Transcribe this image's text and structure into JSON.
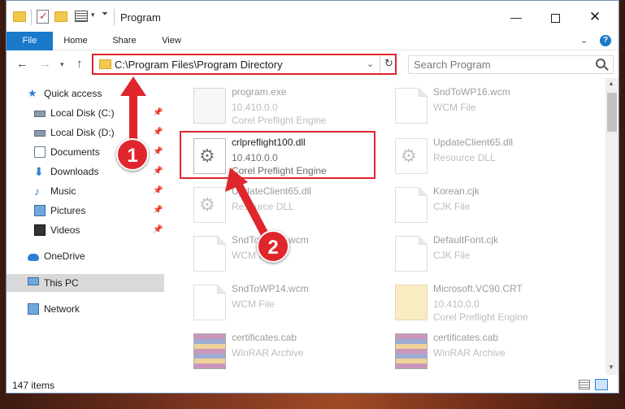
{
  "window": {
    "title": "Program",
    "minimize_glyph": "—",
    "close_glyph": "✕"
  },
  "ribbon": {
    "tabs": [
      "File",
      "Home",
      "Share",
      "View"
    ]
  },
  "nav": {
    "back_glyph": "←",
    "forward_glyph": "→",
    "up_glyph": "↑",
    "address": "C:\\Program Files\\Program Directory",
    "search_placeholder": "Search Program"
  },
  "sidebar": {
    "items": [
      {
        "label": "Quick access",
        "icon": "star-icon",
        "pinned": false
      },
      {
        "label": "Local Disk (C:)",
        "icon": "disk-icon",
        "pinned": true
      },
      {
        "label": "Local Disk (D:)",
        "icon": "disk-icon",
        "pinned": true
      },
      {
        "label": "Documents",
        "icon": "documents-icon",
        "pinned": true
      },
      {
        "label": "Downloads",
        "icon": "download-icon",
        "pinned": true
      },
      {
        "label": "Music",
        "icon": "music-icon",
        "pinned": true
      },
      {
        "label": "Pictures",
        "icon": "pictures-icon",
        "pinned": true
      },
      {
        "label": "Videos",
        "icon": "videos-icon",
        "pinned": true
      },
      {
        "label": "OneDrive",
        "icon": "onedrive-icon",
        "pinned": false
      },
      {
        "label": "This PC",
        "icon": "this-pc-icon",
        "pinned": false,
        "selected": true
      },
      {
        "label": "Network",
        "icon": "network-icon",
        "pinned": false
      }
    ]
  },
  "files": [
    {
      "name": "program.exe",
      "line2": "10.410.0.0",
      "line3": "Corel Preflight Engine",
      "icon": "exe-icon",
      "faded": true
    },
    {
      "name": "SndToWP16.wcm",
      "line2": "WCM File",
      "line3": "",
      "icon": "file-icon",
      "faded": true
    },
    {
      "name": "crlpreflight100.dll",
      "line2": "10.410.0.0",
      "line3": "Corel Preflight Engine",
      "icon": "dll-icon",
      "faded": false
    },
    {
      "name": "UpdateClient65.dll",
      "line2": "Resource DLL",
      "line3": "",
      "icon": "dll-icon",
      "faded": true
    },
    {
      "name": "UpdateClient65.dll",
      "line2": "Resource DLL",
      "line3": "",
      "icon": "dll-icon",
      "faded": true
    },
    {
      "name": "Korean.cjk",
      "line2": "CJK File",
      "line3": "",
      "icon": "file-icon",
      "faded": true
    },
    {
      "name": "SndToWP15.wcm",
      "line2": "WCM File",
      "line3": "",
      "icon": "file-icon",
      "faded": true
    },
    {
      "name": "DefaultFont.cjk",
      "line2": "CJK File",
      "line3": "",
      "icon": "file-icon",
      "faded": true
    },
    {
      "name": "SndToWP14.wcm",
      "line2": "WCM File",
      "line3": "",
      "icon": "file-icon",
      "faded": true
    },
    {
      "name": "Microsoft.VC90.CRT",
      "line2": "10.410.0.0",
      "line3": "Corel Preflight Engine",
      "icon": "zip-icon",
      "faded": true
    },
    {
      "name": "certificates.cab",
      "line2": "WinRAR Archive",
      "line3": "",
      "icon": "rar-icon",
      "faded": true
    },
    {
      "name": "certificates.cab",
      "line2": "WinRAR Archive",
      "line3": "",
      "icon": "rar-icon",
      "faded": true
    }
  ],
  "status": {
    "item_count": "147 items"
  },
  "annotations": {
    "step1": "1",
    "step2": "2",
    "color": "#e0262d"
  }
}
